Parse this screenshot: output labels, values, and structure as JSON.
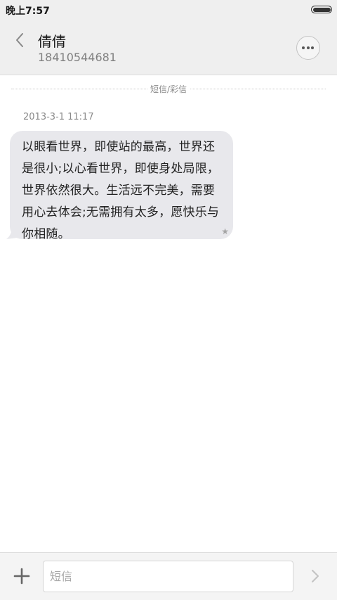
{
  "status_bar": {
    "time": "晚上7:57",
    "battery_level": 1.0
  },
  "header": {
    "contact_name": "倩倩",
    "contact_number": "18410544681",
    "back_icon": "chevron-left-icon",
    "more_icon": "more-horizontal-icon"
  },
  "conversation": {
    "channel_label": "短信/彩信",
    "messages": [
      {
        "timestamp": "2013-3-1 11:17",
        "text": "以眼看世界，即使站的最高，世界还是很小;以心看世界，即使身处局限，世界依然很大。生活远不完美，需要用心去体会;无需拥有太多，愿快乐与你相随。",
        "starred": true,
        "star_glyph": "★"
      }
    ]
  },
  "input_bar": {
    "placeholder": "短信",
    "value": "",
    "add_icon": "plus-icon",
    "send_icon": "chevron-right-icon"
  },
  "colors": {
    "bar_background": "#efefef",
    "bubble_background": "#e8e8ec",
    "secondary_text": "#808080"
  }
}
